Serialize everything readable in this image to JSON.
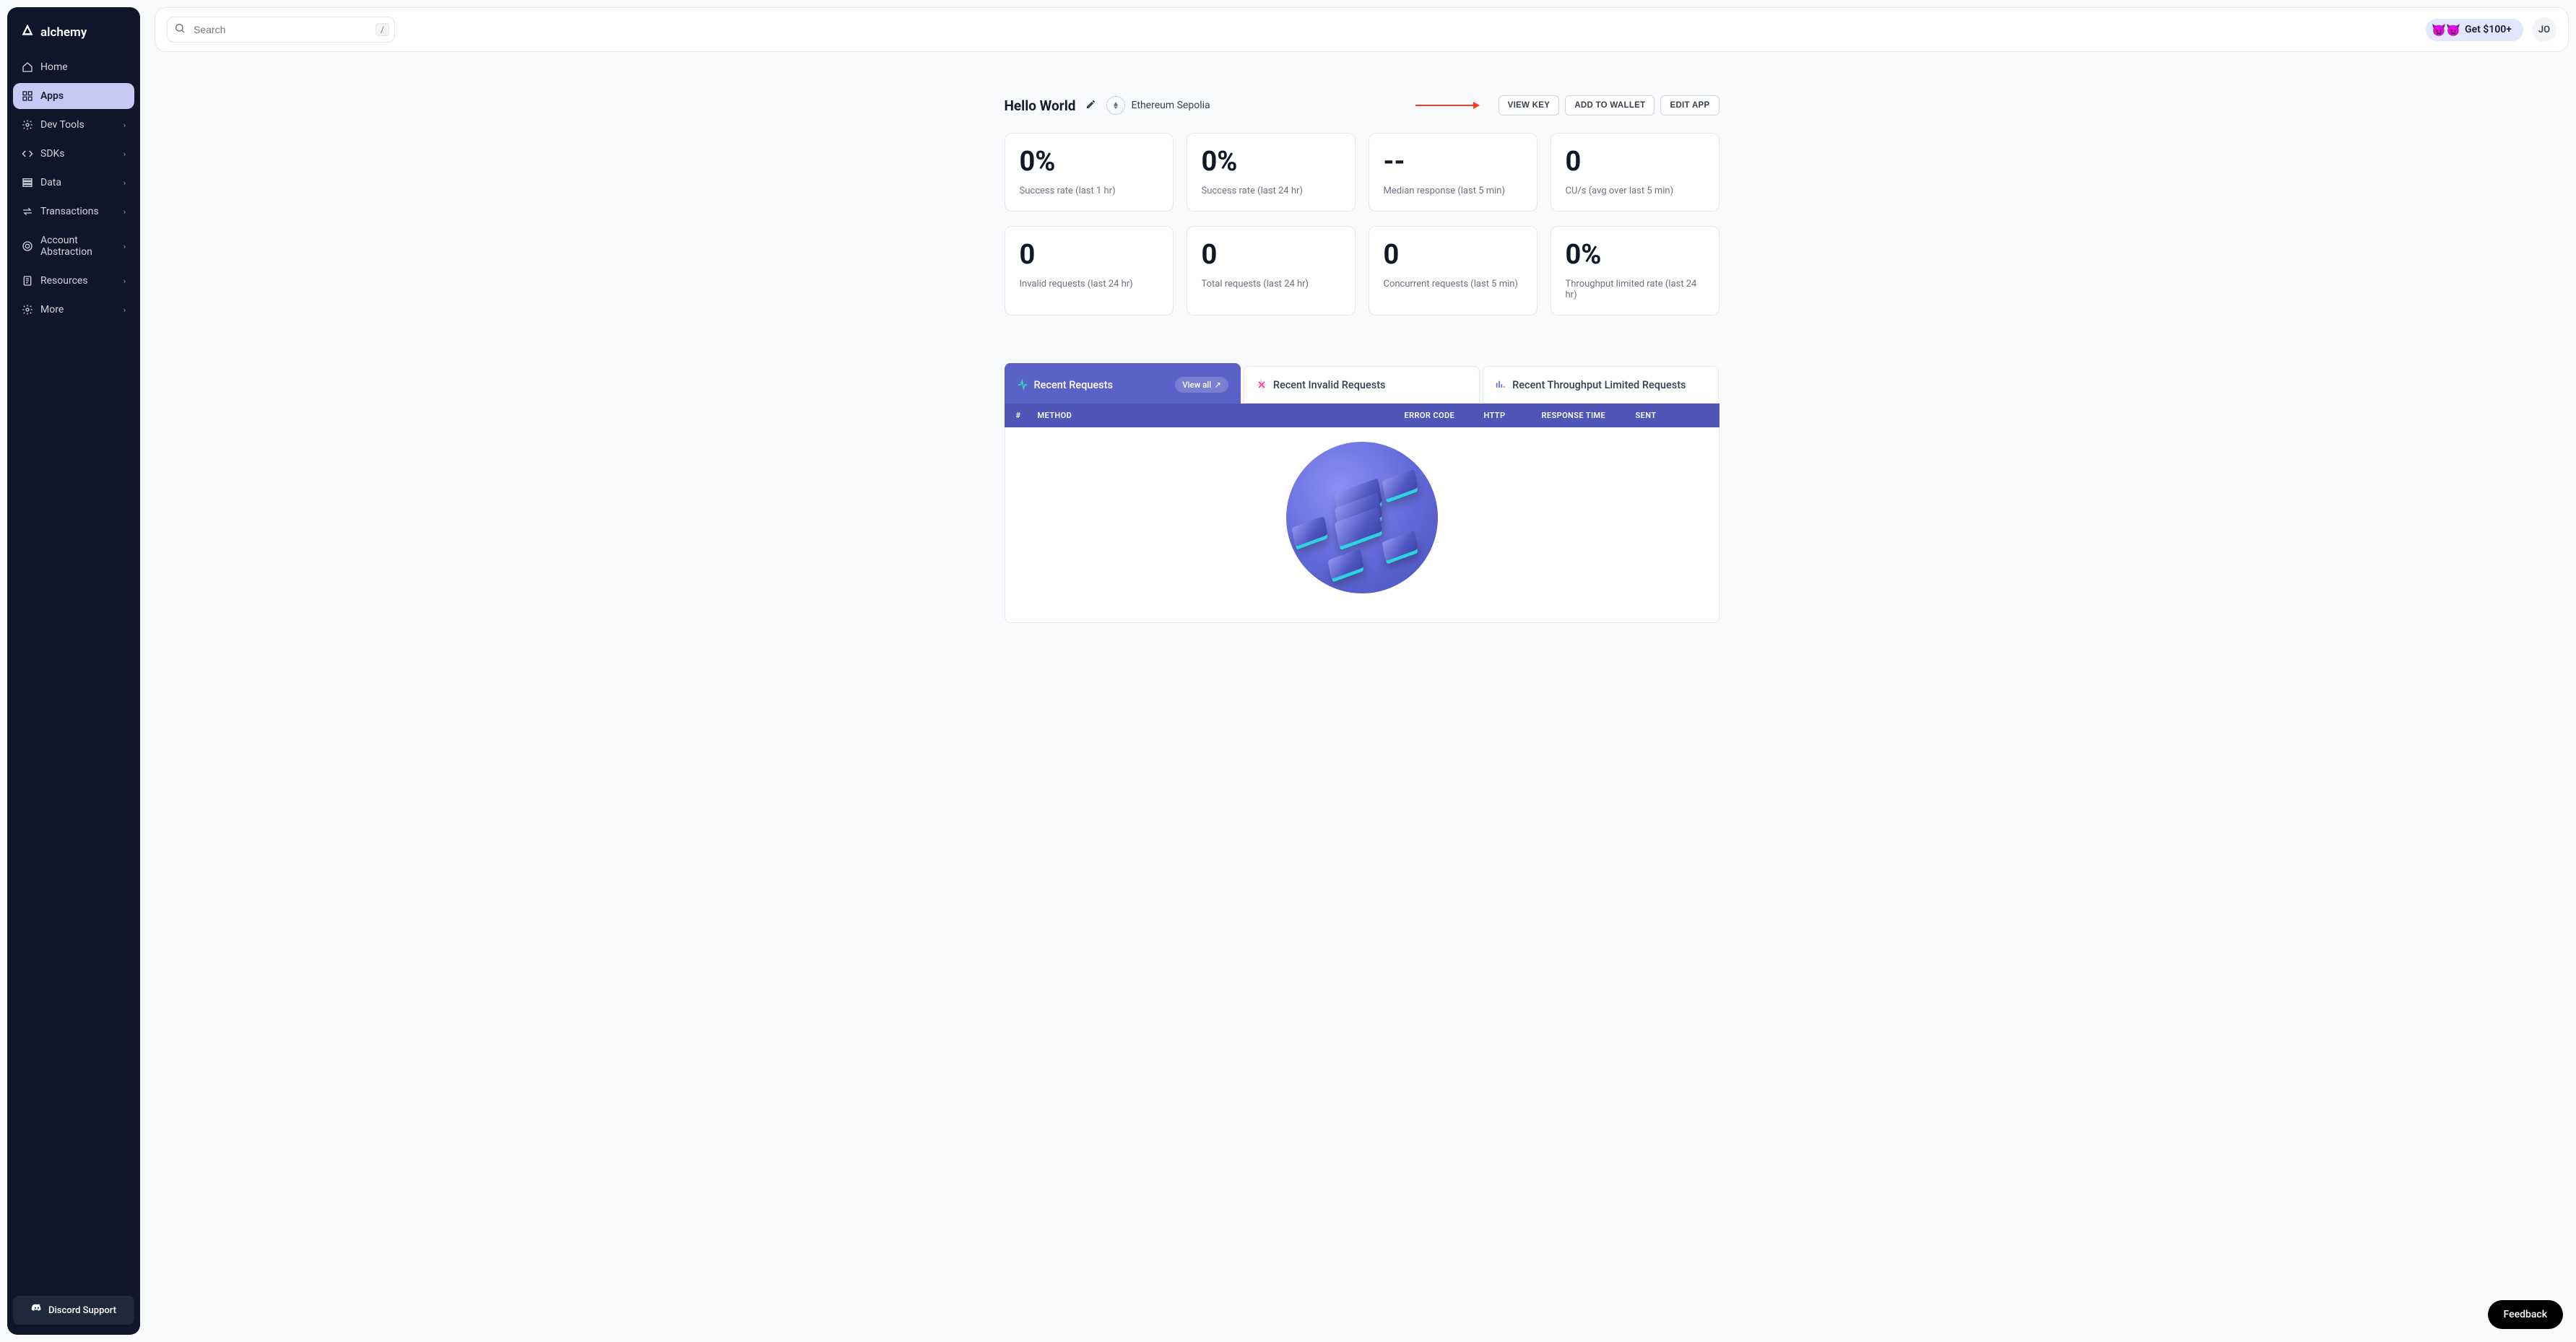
{
  "brand": "alchemy",
  "sidebar": {
    "items": [
      {
        "label": "Home",
        "icon": "home-icon",
        "chevron": false,
        "active": false
      },
      {
        "label": "Apps",
        "icon": "apps-icon",
        "chevron": false,
        "active": true
      },
      {
        "label": "Dev Tools",
        "icon": "gear-icon",
        "chevron": true,
        "active": false
      },
      {
        "label": "SDKs",
        "icon": "code-icon",
        "chevron": true,
        "active": false
      },
      {
        "label": "Data",
        "icon": "data-icon",
        "chevron": true,
        "active": false
      },
      {
        "label": "Transactions",
        "icon": "transfer-icon",
        "chevron": true,
        "active": false
      },
      {
        "label": "Account Abstraction",
        "icon": "target-icon",
        "chevron": true,
        "active": false
      },
      {
        "label": "Resources",
        "icon": "doc-icon",
        "chevron": true,
        "active": false
      },
      {
        "label": "More",
        "icon": "gear-icon",
        "chevron": true,
        "active": false
      }
    ],
    "discord_label": "Discord Support"
  },
  "topbar": {
    "search_placeholder": "Search",
    "search_shortcut": "/",
    "referral_label": "Get $100+",
    "avatar_initials": "JO"
  },
  "app_header": {
    "title": "Hello World",
    "chain": "Ethereum Sepolia",
    "buttons": {
      "view_key": "VIEW KEY",
      "add_wallet": "ADD TO WALLET",
      "edit_app": "EDIT APP"
    }
  },
  "stats_row1": [
    {
      "value": "0%",
      "label": "Success rate (last 1 hr)"
    },
    {
      "value": "0%",
      "label": "Success rate (last 24 hr)"
    },
    {
      "value": "--",
      "label": "Median response (last 5 min)"
    },
    {
      "value": "0",
      "label": "CU/s (avg over last 5 min)"
    }
  ],
  "stats_row2": [
    {
      "value": "0",
      "label": "Invalid requests (last 24 hr)"
    },
    {
      "value": "0",
      "label": "Total requests (last 24 hr)"
    },
    {
      "value": "0",
      "label": "Concurrent requests (last 5 min)"
    },
    {
      "value": "0%",
      "label": "Throughput limited rate (last 24 hr)"
    }
  ],
  "tabs": {
    "recent": {
      "label": "Recent Requests",
      "view_all": "View all"
    },
    "invalid": {
      "label": "Recent Invalid Requests"
    },
    "throughput": {
      "label": "Recent Throughput Limited Requests"
    }
  },
  "table": {
    "columns": {
      "idx": "#",
      "method": "METHOD",
      "error_code": "ERROR CODE",
      "http": "HTTP",
      "response_time": "RESPONSE TIME",
      "sent": "SENT"
    }
  },
  "feedback_label": "Feedback"
}
